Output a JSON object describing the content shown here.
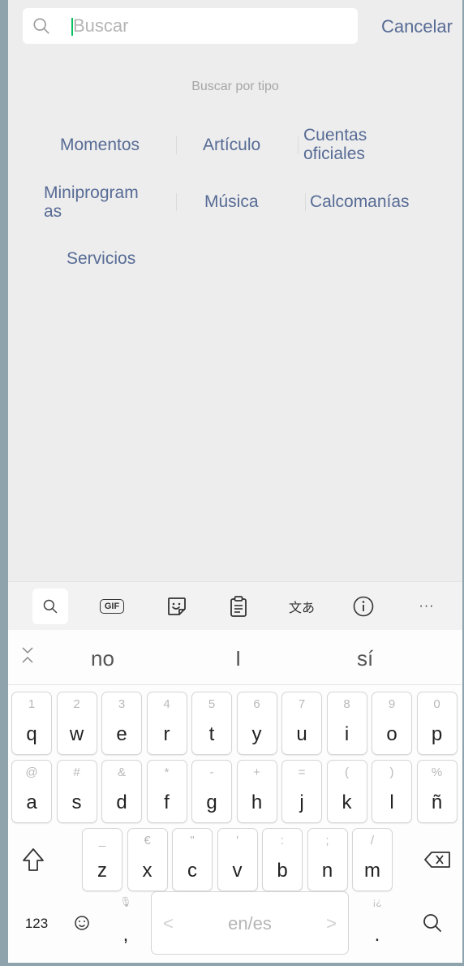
{
  "search": {
    "placeholder": "Buscar",
    "cancel_label": "Cancelar"
  },
  "search_type": {
    "title": "Buscar por tipo",
    "items": [
      {
        "line1": "Momentos",
        "line2": ""
      },
      {
        "line1": "Artículo",
        "line2": ""
      },
      {
        "line1": "Cuentas",
        "line2": "oficiales"
      },
      {
        "line1": "Miniprogram",
        "line2": "as"
      },
      {
        "line1": "Música",
        "line2": ""
      },
      {
        "line1": "Calcomanías",
        "line2": ""
      },
      {
        "line1": "Servicios",
        "line2": ""
      }
    ]
  },
  "toolbar_icons": [
    "search-icon",
    "gif-icon",
    "sticker-icon",
    "clipboard-icon",
    "translate-icon",
    "info-icon",
    "more-icon"
  ],
  "toolbar": {
    "gif_label": "GIF",
    "more_label": "···",
    "info_label": "i",
    "translate_label": "文あ"
  },
  "keyboard": {
    "suggestions": [
      "no",
      "I",
      "sí"
    ],
    "row1": [
      {
        "sec": "1",
        "pri": "q"
      },
      {
        "sec": "2",
        "pri": "w"
      },
      {
        "sec": "3",
        "pri": "e"
      },
      {
        "sec": "4",
        "pri": "r"
      },
      {
        "sec": "5",
        "pri": "t"
      },
      {
        "sec": "6",
        "pri": "y"
      },
      {
        "sec": "7",
        "pri": "u"
      },
      {
        "sec": "8",
        "pri": "i"
      },
      {
        "sec": "9",
        "pri": "o"
      },
      {
        "sec": "0",
        "pri": "p"
      }
    ],
    "row2": [
      {
        "sec": "@",
        "pri": "a"
      },
      {
        "sec": "#",
        "pri": "s"
      },
      {
        "sec": "&",
        "pri": "d"
      },
      {
        "sec": "*",
        "pri": "f"
      },
      {
        "sec": "-",
        "pri": "g"
      },
      {
        "sec": "+",
        "pri": "h"
      },
      {
        "sec": "=",
        "pri": "j"
      },
      {
        "sec": "(",
        "pri": "k"
      },
      {
        "sec": ")",
        "pri": "l"
      },
      {
        "sec": "%",
        "pri": "ñ"
      }
    ],
    "row3": [
      {
        "sec": "_",
        "pri": "z"
      },
      {
        "sec": "€",
        "pri": "x"
      },
      {
        "sec": "\"",
        "pri": "c"
      },
      {
        "sec": "'",
        "pri": "v"
      },
      {
        "sec": ":",
        "pri": "b"
      },
      {
        "sec": ";",
        "pri": "n"
      },
      {
        "sec": "/",
        "pri": "m"
      }
    ],
    "numbers_label": "123",
    "comma": {
      "sec": "🎙",
      "pri": ","
    },
    "space_label": "en/es",
    "period": {
      "sec": "¡¿",
      "pri": "."
    },
    "space_left_arrow": "<",
    "space_right_arrow": ">"
  }
}
